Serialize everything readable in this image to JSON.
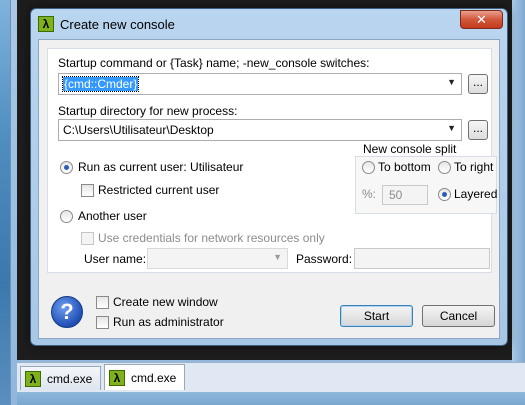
{
  "dialog": {
    "title": "Create new console",
    "close_glyph": "✕",
    "app_icon": "lambda-icon"
  },
  "startup": {
    "command_label": "Startup command or {Task} name; -new_console switches:",
    "command_value": "{cmd::Cmder}",
    "command_browse": "...",
    "dir_label": "Startup directory for new process:",
    "dir_value": "C:\\Users\\Utilisateur\\Desktop",
    "dir_browse": "..."
  },
  "run_as": {
    "current_user_label": "Run as current user: Utilisateur",
    "restricted_label": "Restricted current user",
    "another_user_label": "Another user",
    "use_credentials_label": "Use credentials for network resources only",
    "user_name_label": "User name:",
    "user_name_value": "",
    "password_label": "Password:",
    "password_value": ""
  },
  "split": {
    "title": "New console split",
    "to_bottom_label": "To bottom",
    "to_right_label": "To right",
    "percent_label": "%:",
    "percent_value": "50",
    "layered_label": "Layered",
    "selected": "Layered"
  },
  "footer": {
    "help_glyph": "?",
    "create_new_window_label": "Create new window",
    "run_as_admin_label": "Run as administrator",
    "start_label": "Start",
    "cancel_label": "Cancel"
  },
  "tabs": [
    {
      "label": "cmd.exe",
      "active": false
    },
    {
      "label": "cmd.exe",
      "active": true
    }
  ],
  "colors": {
    "accent": "#3399ff",
    "lambda_green": "#7fb11a",
    "close_red": "#c13a1e"
  }
}
